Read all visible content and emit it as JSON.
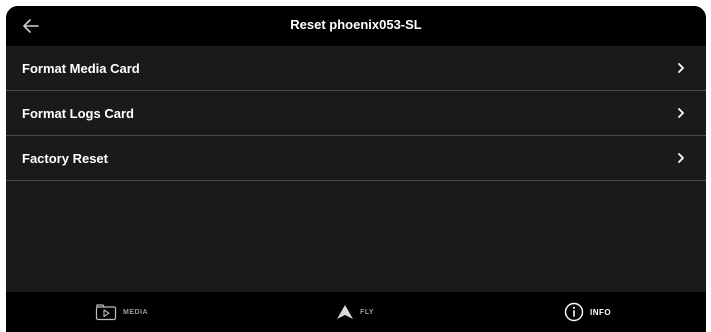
{
  "header": {
    "title": "Reset phoenix053-SL",
    "back_icon": "arrow-left-icon"
  },
  "menu": {
    "items": [
      {
        "label": "Format Media Card",
        "icon": "chevron-right-icon"
      },
      {
        "label": "Format Logs Card",
        "icon": "chevron-right-icon"
      },
      {
        "label": "Factory Reset",
        "icon": "chevron-right-icon"
      }
    ]
  },
  "footer": {
    "nav": [
      {
        "label": "MEDIA",
        "icon": "media-play-icon",
        "active": false
      },
      {
        "label": "FLY",
        "icon": "fly-arrow-icon",
        "active": false
      },
      {
        "label": "INFO",
        "icon": "info-icon",
        "active": true
      }
    ]
  },
  "colors": {
    "background": "#1a1a1a",
    "bar": "#000000",
    "divider": "#4a4a4a",
    "text": "#ffffff",
    "inactive_text": "#9a9a9a"
  }
}
